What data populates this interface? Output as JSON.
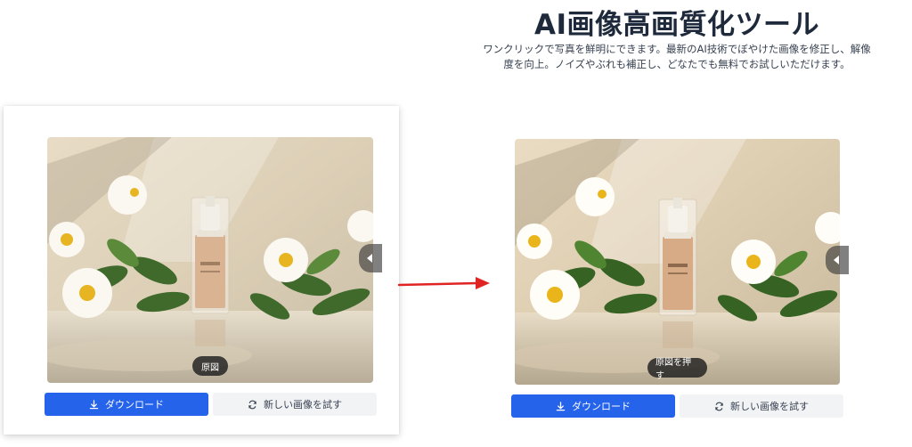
{
  "hero": {
    "title": "AI画像高画質化ツール",
    "description": "ワンクリックで写真を鮮明にできます。最新のAI技術でぼやけた画像を修正し、解像度を向上。ノイズやぶれも補正し、どなたでも無料でお試しいただけます。"
  },
  "original_panel": {
    "tag_label": "原図",
    "download_label": "ダウンロード",
    "try_new_label": "新しい画像を試す"
  },
  "result_panel": {
    "tag_label": "原図を押す",
    "download_label": "ダウンロード",
    "try_new_label": "新しい画像を試す"
  },
  "colors": {
    "primary": "#2563eb",
    "arrow": "#e02424",
    "title": "#1e2a3b"
  },
  "icons": {
    "download": "download-icon",
    "refresh": "refresh-icon",
    "handle": "chevron-left-icon",
    "arrow": "right-arrow-icon"
  }
}
